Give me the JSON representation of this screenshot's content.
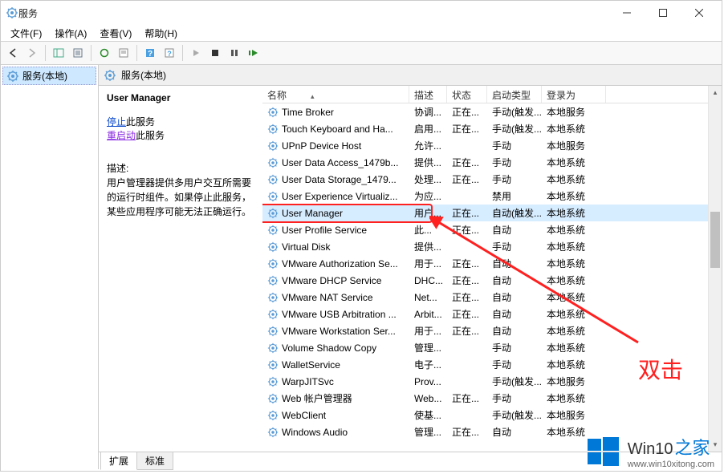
{
  "window": {
    "title": "服务"
  },
  "menus": {
    "file": "文件(F)",
    "action": "操作(A)",
    "view": "查看(V)",
    "help": "帮助(H)"
  },
  "tree": {
    "root": "服务(本地)"
  },
  "header": {
    "title": "服务(本地)"
  },
  "detail": {
    "title": "User Manager",
    "stop": "停止",
    "stop_suffix": "此服务",
    "restart": "重启动",
    "restart_suffix": "此服务",
    "desc_label": "描述:",
    "desc": "用户管理器提供多用户交互所需要的运行时组件。如果停止此服务，某些应用程序可能无法正确运行。"
  },
  "columns": {
    "name": "名称",
    "desc": "描述",
    "status": "状态",
    "startup": "启动类型",
    "logon": "登录为"
  },
  "rows": [
    {
      "name": "Time Broker",
      "desc": "协调...",
      "status": "正在...",
      "startup": "手动(触发...",
      "logon": "本地服务"
    },
    {
      "name": "Touch Keyboard and Ha...",
      "desc": "启用...",
      "status": "正在...",
      "startup": "手动(触发...",
      "logon": "本地系统"
    },
    {
      "name": "UPnP Device Host",
      "desc": "允许...",
      "status": "",
      "startup": "手动",
      "logon": "本地服务"
    },
    {
      "name": "User Data Access_1479b...",
      "desc": "提供...",
      "status": "正在...",
      "startup": "手动",
      "logon": "本地系统"
    },
    {
      "name": "User Data Storage_1479...",
      "desc": "处理...",
      "status": "正在...",
      "startup": "手动",
      "logon": "本地系统"
    },
    {
      "name": "User Experience Virtualiz...",
      "desc": "为应...",
      "status": "",
      "startup": "禁用",
      "logon": "本地系统"
    },
    {
      "name": "User Manager",
      "desc": "用户...",
      "status": "正在...",
      "startup": "自动(触发...",
      "logon": "本地系统",
      "selected": true
    },
    {
      "name": "User Profile Service",
      "desc": "此...",
      "status": "正在...",
      "startup": "自动",
      "logon": "本地系统"
    },
    {
      "name": "Virtual Disk",
      "desc": "提供...",
      "status": "",
      "startup": "手动",
      "logon": "本地系统"
    },
    {
      "name": "VMware Authorization Se...",
      "desc": "用于...",
      "status": "正在...",
      "startup": "自动",
      "logon": "本地系统"
    },
    {
      "name": "VMware DHCP Service",
      "desc": "DHC...",
      "status": "正在...",
      "startup": "自动",
      "logon": "本地系统"
    },
    {
      "name": "VMware NAT Service",
      "desc": "Net...",
      "status": "正在...",
      "startup": "自动",
      "logon": "本地系统"
    },
    {
      "name": "VMware USB Arbitration ...",
      "desc": "Arbit...",
      "status": "正在...",
      "startup": "自动",
      "logon": "本地系统"
    },
    {
      "name": "VMware Workstation Ser...",
      "desc": "用于...",
      "status": "正在...",
      "startup": "自动",
      "logon": "本地系统"
    },
    {
      "name": "Volume Shadow Copy",
      "desc": "管理...",
      "status": "",
      "startup": "手动",
      "logon": "本地系统"
    },
    {
      "name": "WalletService",
      "desc": "电子...",
      "status": "",
      "startup": "手动",
      "logon": "本地系统"
    },
    {
      "name": "WarpJITSvc",
      "desc": "Prov...",
      "status": "",
      "startup": "手动(触发...",
      "logon": "本地服务"
    },
    {
      "name": "Web 帐户管理器",
      "desc": "Web...",
      "status": "正在...",
      "startup": "手动",
      "logon": "本地系统"
    },
    {
      "name": "WebClient",
      "desc": "使基...",
      "status": "",
      "startup": "手动(触发...",
      "logon": "本地服务"
    },
    {
      "name": "Windows Audio",
      "desc": "管理...",
      "status": "正在...",
      "startup": "自动",
      "logon": "本地系统"
    }
  ],
  "tabs": {
    "extended": "扩展",
    "standard": "标准"
  },
  "annotation": {
    "text": "双击"
  },
  "watermark": {
    "brand": "Win10",
    "suffix": "之家",
    "url": "www.win10xitong.com"
  }
}
